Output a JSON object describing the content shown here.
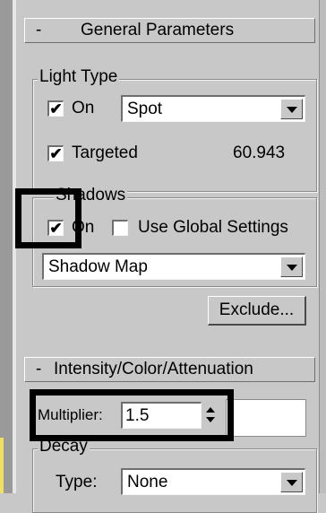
{
  "general_parameters": {
    "title": "General Parameters",
    "collapse_symbol": "-",
    "light_type": {
      "label": "Light Type",
      "on_label": "On",
      "on_checked": true,
      "type_value": "Spot",
      "targeted_label": "Targeted",
      "targeted_checked": true,
      "target_distance": "60.943"
    },
    "shadows": {
      "label": "Shadows",
      "on_label": "On",
      "on_checked": true,
      "use_global_label": "Use Global Settings",
      "use_global_checked": false,
      "shadow_type": "Shadow Map",
      "exclude_label": "Exclude..."
    }
  },
  "intensity": {
    "title": "Intensity/Color/Attenuation",
    "collapse_symbol": "-",
    "multiplier_label": "Multiplier:",
    "multiplier_value": "1.5",
    "color_swatch": "#ffffff",
    "decay": {
      "label": "Decay",
      "type_label": "Type:",
      "type_value": "None"
    }
  },
  "check_mark": "✔",
  "icons": {
    "dropdown": "triangle-down-icon",
    "spinner": "spinner-arrows-icon"
  }
}
